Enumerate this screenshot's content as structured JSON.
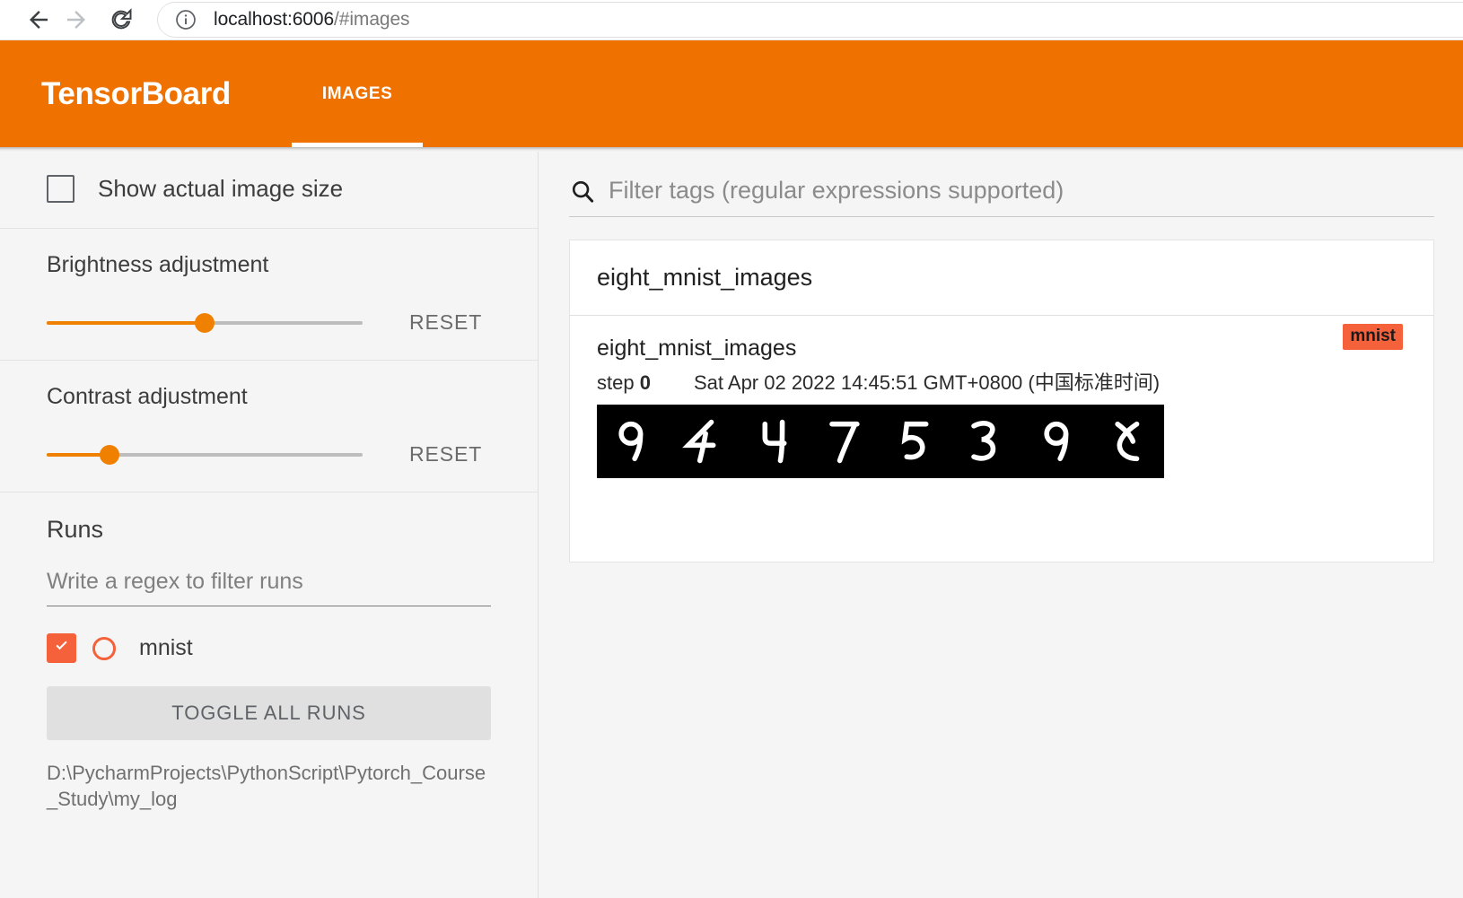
{
  "browser": {
    "back_icon": "arrow-left-icon",
    "forward_icon": "arrow-right-icon",
    "reload_icon": "reload-icon",
    "info_icon": "info-circle-icon",
    "url_host": "localhost:6006",
    "url_path": "/#images"
  },
  "header": {
    "title": "TensorBoard",
    "accent_color": "#ef7100",
    "tabs": [
      {
        "label": "IMAGES",
        "active": true
      }
    ]
  },
  "sidebar": {
    "show_actual_size": {
      "label": "Show actual image size",
      "checked": false
    },
    "brightness": {
      "label": "Brightness adjustment",
      "reset_label": "RESET",
      "value_percent": 50
    },
    "contrast": {
      "label": "Contrast adjustment",
      "reset_label": "RESET",
      "value_percent": 20
    },
    "runs": {
      "title": "Runs",
      "filter_placeholder": "Write a regex to filter runs",
      "items": [
        {
          "name": "mnist",
          "checked": true,
          "color": "#f4613b"
        }
      ],
      "toggle_all_label": "TOGGLE ALL RUNS",
      "logdir": "D:\\PycharmProjects\\PythonScript\\Pytorch_Course_Study\\my_log"
    }
  },
  "main": {
    "tag_filter": {
      "icon": "search-icon",
      "placeholder": "Filter tags (regular expressions supported)"
    },
    "card_group": {
      "title": "eight_mnist_images",
      "cards": [
        {
          "tag": "eight_mnist_images",
          "run_badge": "mnist",
          "step_label": "step",
          "step_value": "0",
          "timestamp": "Sat Apr 02 2022 14:45:51 GMT+0800 (中国标准时间)",
          "image_alt": "eight-mnist-digits-strip",
          "digits": [
            "9",
            "4",
            "4",
            "7",
            "5",
            "3",
            "9",
            "5"
          ]
        }
      ]
    }
  }
}
